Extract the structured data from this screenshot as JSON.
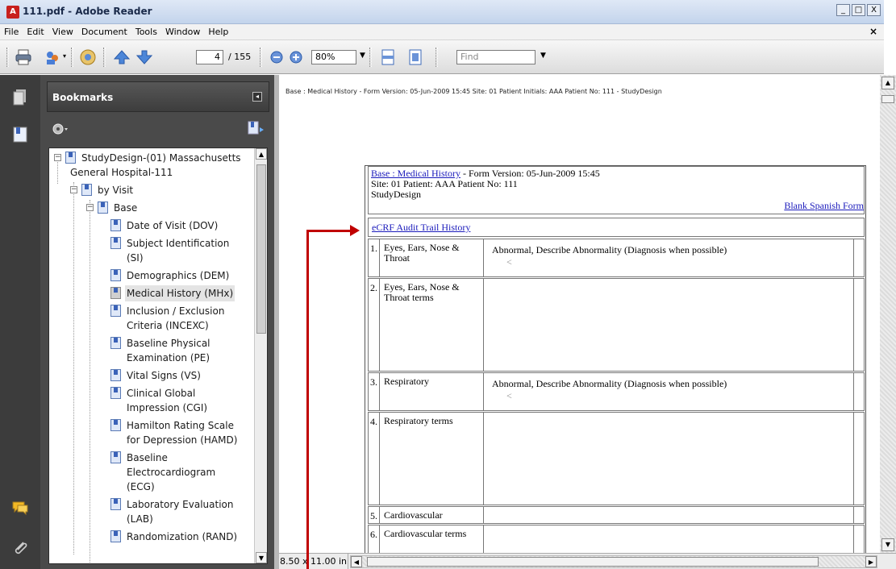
{
  "window": {
    "title": "111.pdf - Adobe Reader",
    "buttons": [
      "_",
      "□",
      "X"
    ]
  },
  "menu": {
    "items": [
      "File",
      "Edit",
      "View",
      "Document",
      "Tools",
      "Window",
      "Help"
    ],
    "close_label": "×"
  },
  "toolbar": {
    "current_page": "4",
    "page_count": "/ 155",
    "zoom": "80%",
    "find_placeholder": "Find"
  },
  "bookmarks": {
    "header": "Bookmarks",
    "tree": [
      {
        "label": "StudyDesign-(01) Massachusetts",
        "label2": "General Hospital-111"
      },
      {
        "label": "by Visit"
      },
      {
        "label": "Base"
      },
      {
        "label": "Date of Visit (DOV)"
      },
      {
        "label": "Subject Identification",
        "label2": "(SI)"
      },
      {
        "label": "Demographics (DEM)"
      },
      {
        "label": "Medical History (MHx)"
      },
      {
        "label": "Inclusion / Exclusion",
        "label2": "Criteria (INCEXC)"
      },
      {
        "label": "Baseline Physical",
        "label2": "Examination (PE)"
      },
      {
        "label": "Vital Signs (VS)"
      },
      {
        "label": "Clinical Global",
        "label2": "Impression (CGI)"
      },
      {
        "label": "Hamilton Rating Scale",
        "label2": "for Depression (HAMD)"
      },
      {
        "label": "Baseline",
        "label2": "Electrocardiogram",
        "label3": "(ECG)"
      },
      {
        "label": "Laboratory Evaluation",
        "label2": "(LAB)"
      },
      {
        "label": "Randomization (RAND)"
      }
    ]
  },
  "document": {
    "page_header": "Base : Medical History - Form Version: 05-Jun-2009 15:45 Site: 01 Patient Initials: AAA Patient No: 111 - StudyDesign",
    "form": {
      "link": "Base : Medical History",
      "version": " - Form Version: 05-Jun-2009 15:45",
      "site_line": "Site: 01   Patient: AAA   Patient No: 111",
      "study": "StudyDesign",
      "blank_link": "Blank Spanish Form",
      "audit_link": "eCRF Audit Trail History",
      "rows": [
        {
          "num": "1.",
          "label": "Eyes, Ears, Nose & Throat",
          "value": "Abnormal, Describe Abnormality (Diagnosis when possible)",
          "sub": "<"
        },
        {
          "num": "2.",
          "label": "Eyes, Ears, Nose & Throat terms",
          "value": "",
          "sub": ""
        },
        {
          "num": "3.",
          "label": "Respiratory",
          "value": "Abnormal, Describe Abnormality (Diagnosis when possible)",
          "sub": "<"
        },
        {
          "num": "4.",
          "label": "Respiratory terms",
          "value": "",
          "sub": ""
        },
        {
          "num": "5.",
          "label": "Cardiovascular",
          "value": "",
          "sub": ""
        },
        {
          "num": "6.",
          "label": "Cardiovascular terms",
          "value": "",
          "sub": ""
        }
      ]
    }
  },
  "status": {
    "page_size": "8.50 x 11.00 in"
  },
  "colors": {
    "accent_red": "#c00000",
    "link_blue": "#1a1abb",
    "panel_dark": "#4a4a4a"
  }
}
